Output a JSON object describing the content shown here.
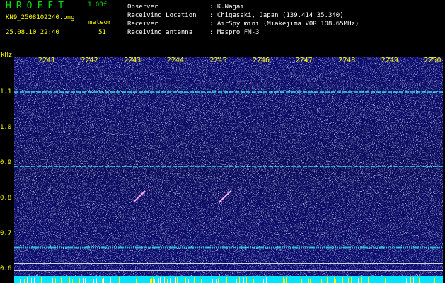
{
  "header": {
    "app_title": "HROFFT",
    "version": "1.00f",
    "filename": "KN9_2508102240.png",
    "datetime": "25.08.10 22:40",
    "mode": "meteor",
    "count": "51"
  },
  "info": [
    {
      "key": "Observer",
      "value": ": K.Nagai"
    },
    {
      "key": "Receiving Location",
      "value": ": Chigasaki, Japan (139.414 35.340)"
    },
    {
      "key": "Receiver",
      "value": ": AirSpy mini (Miakejima VOR 108.65MHz)"
    },
    {
      "key": "Receiving antenna",
      "value": ": Maspro FM-3"
    }
  ],
  "colors": {
    "background": "#000000",
    "spectrogram_base": "#0a0a66",
    "title_green": "#00e000",
    "label_yellow": "#ffff00",
    "trace_cyan": "#33ffff"
  },
  "chart_data": {
    "type": "heatmap",
    "xlabel": "",
    "ylabel": "kHz",
    "x_ticks": [
      "2241",
      "2242",
      "2243",
      "2244",
      "2245",
      "2246",
      "2247",
      "2248",
      "2249",
      "2250"
    ],
    "y_ticks": [
      "1.1",
      "1.0",
      "0.9",
      "0.8",
      "0.7",
      "0.6"
    ],
    "ylim": [
      0.58,
      1.2
    ],
    "carrier_lines_khz": [
      1.1,
      0.89,
      0.66
    ],
    "meteor_echoes": [
      {
        "time": "2243",
        "freq_khz": [
          0.79,
          0.82
        ]
      },
      {
        "time": "2245",
        "freq_khz": [
          0.79,
          0.82
        ]
      }
    ]
  }
}
